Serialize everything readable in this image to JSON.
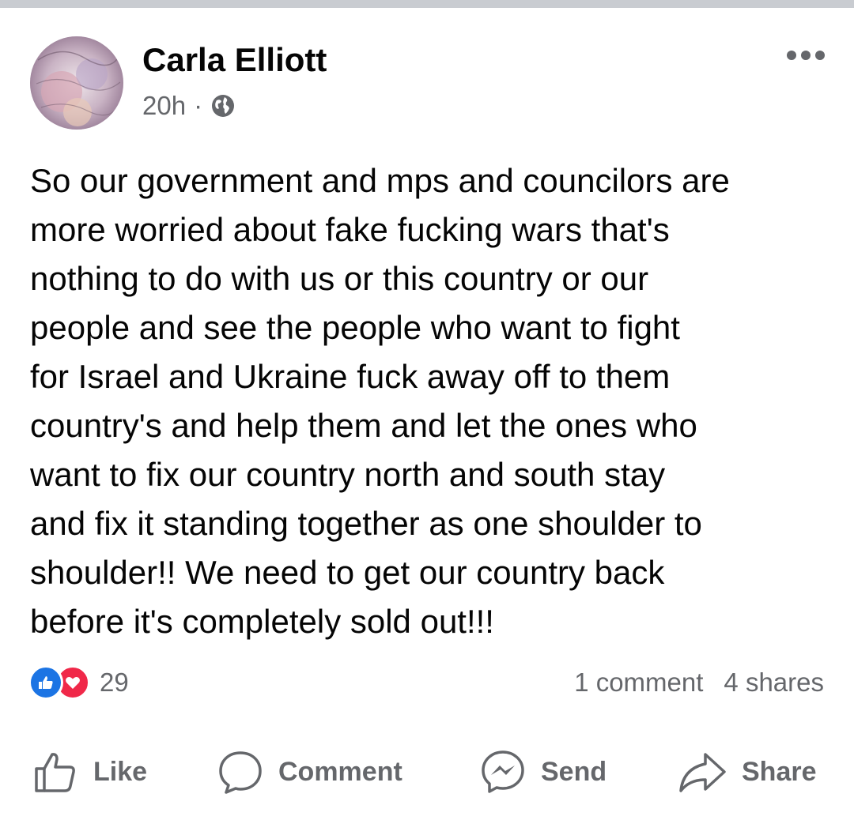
{
  "post": {
    "author_name": "Carla Elliott",
    "timestamp": "20h",
    "separator": "·",
    "privacy_icon": "globe-icon",
    "more_icon": "more-horizontal-icon",
    "body_lines": [
      "So our government and mps and councilors are",
      "more worried about fake fucking wars that's",
      "nothing to do with us or this country or our",
      "people and see the people who want to fight",
      "for Israel and Ukraine fuck away off to them",
      "country's and help them and let the ones who",
      "want to fix our country north and south stay",
      "and fix it standing together as one shoulder to",
      "shoulder!! We need to get our country back",
      "before it's completely sold out!!!"
    ]
  },
  "stats": {
    "reaction_icons": [
      "like-reaction-icon",
      "love-reaction-icon"
    ],
    "reaction_count": "29",
    "comments": "1 comment",
    "shares": "4 shares"
  },
  "actions": {
    "like": "Like",
    "comment": "Comment",
    "send": "Send",
    "share": "Share"
  },
  "colors": {
    "text_primary": "#050505",
    "text_secondary": "#65676b",
    "like_blue": "#1b74e4",
    "love_red": "#f02849",
    "top_strip": "#c9ccd1"
  }
}
